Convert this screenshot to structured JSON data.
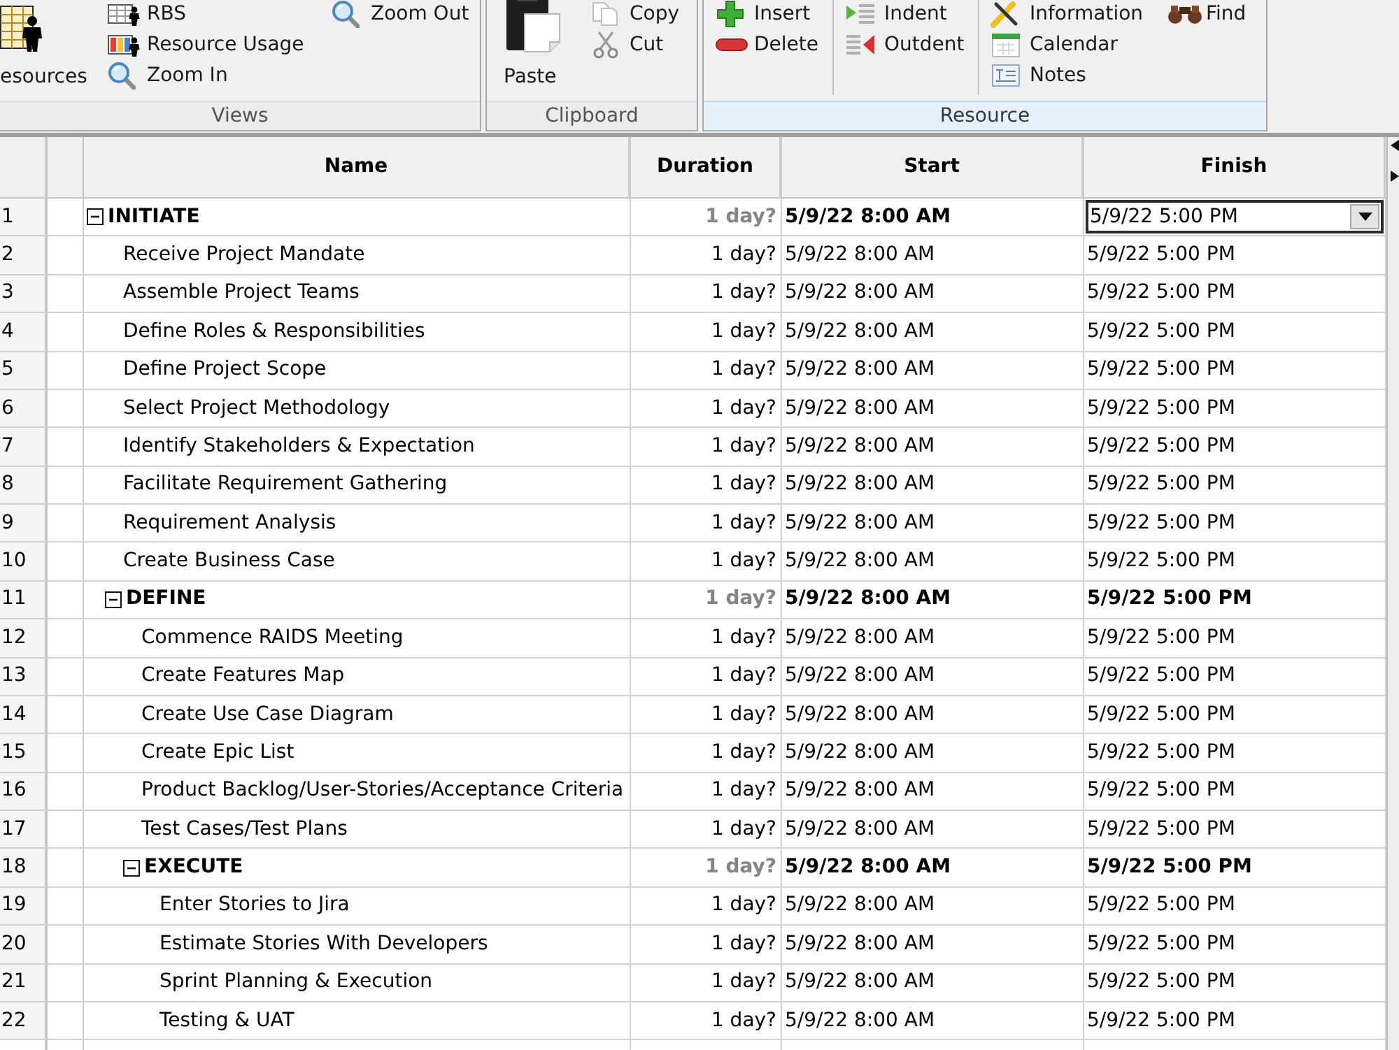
{
  "ribbon": {
    "groups": [
      {
        "label": "Views",
        "selected": false,
        "columns": [
          [
            {
              "label": "esources",
              "kind": "large"
            }
          ],
          [
            {
              "label": "RBS",
              "kind": "small"
            },
            {
              "label": "Resource Usage",
              "kind": "small"
            },
            {
              "label": "Zoom In",
              "kind": "small"
            }
          ],
          [
            {
              "label": "Zoom Out",
              "kind": "small"
            }
          ]
        ]
      },
      {
        "label": "Clipboard",
        "selected": false,
        "columns": [
          [
            {
              "label": "Paste",
              "kind": "large"
            }
          ],
          [
            {
              "label": "Copy",
              "kind": "small"
            },
            {
              "label": "Cut",
              "kind": "small"
            }
          ]
        ]
      },
      {
        "label": "Resource",
        "selected": true,
        "columns": [
          [
            {
              "label": "Insert",
              "kind": "small"
            },
            {
              "label": "Delete",
              "kind": "small"
            }
          ],
          [
            {
              "label": "Indent",
              "kind": "small"
            },
            {
              "label": "Outdent",
              "kind": "small"
            }
          ],
          [
            {
              "label": "Information",
              "kind": "small"
            },
            {
              "label": "Calendar",
              "kind": "small"
            },
            {
              "label": "Notes",
              "kind": "small"
            }
          ],
          [
            {
              "label": "Find",
              "kind": "small"
            }
          ]
        ]
      }
    ]
  },
  "table": {
    "columns": [
      "Name",
      "Duration",
      "Start",
      "Finish"
    ],
    "rows": [
      {
        "number": "1",
        "kind": "summary",
        "expanded": true,
        "name": "INITIATE",
        "duration": "1 day?",
        "start": "5/9/22 8:00 AM",
        "finish": "5/9/22 5:00 PM",
        "editing": true,
        "children": [
          {
            "number": "2",
            "kind": "task",
            "name": "Receive Project Mandate",
            "duration": "1 day?",
            "start": "5/9/22 8:00 AM",
            "finish": "5/9/22 5:00 PM",
            "editing": false
          },
          {
            "number": "3",
            "kind": "task",
            "name": "Assemble Project Teams",
            "duration": "1 day?",
            "start": "5/9/22 8:00 AM",
            "finish": "5/9/22 5:00 PM",
            "editing": false
          },
          {
            "number": "4",
            "kind": "task",
            "name": "Define Roles & Responsibilities",
            "duration": "1 day?",
            "start": "5/9/22 8:00 AM",
            "finish": "5/9/22 5:00 PM",
            "editing": false
          },
          {
            "number": "5",
            "kind": "task",
            "name": "Define Project Scope",
            "duration": "1 day?",
            "start": "5/9/22 8:00 AM",
            "finish": "5/9/22 5:00 PM",
            "editing": false
          },
          {
            "number": "6",
            "kind": "task",
            "name": "Select Project Methodology",
            "duration": "1 day?",
            "start": "5/9/22 8:00 AM",
            "finish": "5/9/22 5:00 PM",
            "editing": false
          },
          {
            "number": "7",
            "kind": "task",
            "name": "Identify Stakeholders & Expectation",
            "duration": "1 day?",
            "start": "5/9/22 8:00 AM",
            "finish": "5/9/22 5:00 PM",
            "editing": false
          },
          {
            "number": "8",
            "kind": "task",
            "name": "Facilitate Requirement Gathering",
            "duration": "1 day?",
            "start": "5/9/22 8:00 AM",
            "finish": "5/9/22 5:00 PM",
            "editing": false
          },
          {
            "number": "9",
            "kind": "task",
            "name": "Requirement Analysis",
            "duration": "1 day?",
            "start": "5/9/22 8:00 AM",
            "finish": "5/9/22 5:00 PM",
            "editing": false
          },
          {
            "number": "10",
            "kind": "task",
            "name": "Create Business Case",
            "duration": "1 day?",
            "start": "5/9/22 8:00 AM",
            "finish": "5/9/22 5:00 PM",
            "editing": false
          },
          {
            "number": "11",
            "kind": "summary",
            "expanded": true,
            "name": "DEFINE",
            "duration": "1 day?",
            "start": "5/9/22 8:00 AM",
            "finish": "5/9/22 5:00 PM",
            "editing": false,
            "children": [
              {
                "number": "12",
                "kind": "task",
                "name": "Commence RAIDS Meeting",
                "duration": "1 day?",
                "start": "5/9/22 8:00 AM",
                "finish": "5/9/22 5:00 PM",
                "editing": false
              },
              {
                "number": "13",
                "kind": "task",
                "name": "Create Features Map",
                "duration": "1 day?",
                "start": "5/9/22 8:00 AM",
                "finish": "5/9/22 5:00 PM",
                "editing": false
              },
              {
                "number": "14",
                "kind": "task",
                "name": "Create Use Case Diagram",
                "duration": "1 day?",
                "start": "5/9/22 8:00 AM",
                "finish": "5/9/22 5:00 PM",
                "editing": false
              },
              {
                "number": "15",
                "kind": "task",
                "name": "Create Epic List",
                "duration": "1 day?",
                "start": "5/9/22 8:00 AM",
                "finish": "5/9/22 5:00 PM",
                "editing": false
              },
              {
                "number": "16",
                "kind": "task",
                "name": "Product Backlog/User-Stories/Acceptance Criteria",
                "duration": "1 day?",
                "start": "5/9/22 8:00 AM",
                "finish": "5/9/22 5:00 PM",
                "editing": false
              },
              {
                "number": "17",
                "kind": "task",
                "name": "Test Cases/Test Plans",
                "duration": "1 day?",
                "start": "5/9/22 8:00 AM",
                "finish": "5/9/22 5:00 PM",
                "editing": false
              },
              {
                "number": "18",
                "kind": "summary",
                "expanded": true,
                "name": "EXECUTE",
                "duration": "1 day?",
                "start": "5/9/22 8:00 AM",
                "finish": "5/9/22 5:00 PM",
                "editing": false,
                "children": [
                  {
                    "number": "19",
                    "kind": "task",
                    "name": "Enter Stories to Jira",
                    "duration": "1 day?",
                    "start": "5/9/22 8:00 AM",
                    "finish": "5/9/22 5:00 PM",
                    "editing": false
                  },
                  {
                    "number": "20",
                    "kind": "task",
                    "name": "Estimate Stories With Developers",
                    "duration": "1 day?",
                    "start": "5/9/22 8:00 AM",
                    "finish": "5/9/22 5:00 PM",
                    "editing": false
                  },
                  {
                    "number": "21",
                    "kind": "task",
                    "name": "Sprint Planning & Execution",
                    "duration": "1 day?",
                    "start": "5/9/22 8:00 AM",
                    "finish": "5/9/22 5:00 PM",
                    "editing": false
                  },
                  {
                    "number": "22",
                    "kind": "task",
                    "name": "Testing & UAT",
                    "duration": "1 day?",
                    "start": "5/9/22 8:00 AM",
                    "finish": "5/9/22 5:00 PM",
                    "editing": false
                  }
                ]
              }
            ]
          }
        ]
      }
    ]
  }
}
